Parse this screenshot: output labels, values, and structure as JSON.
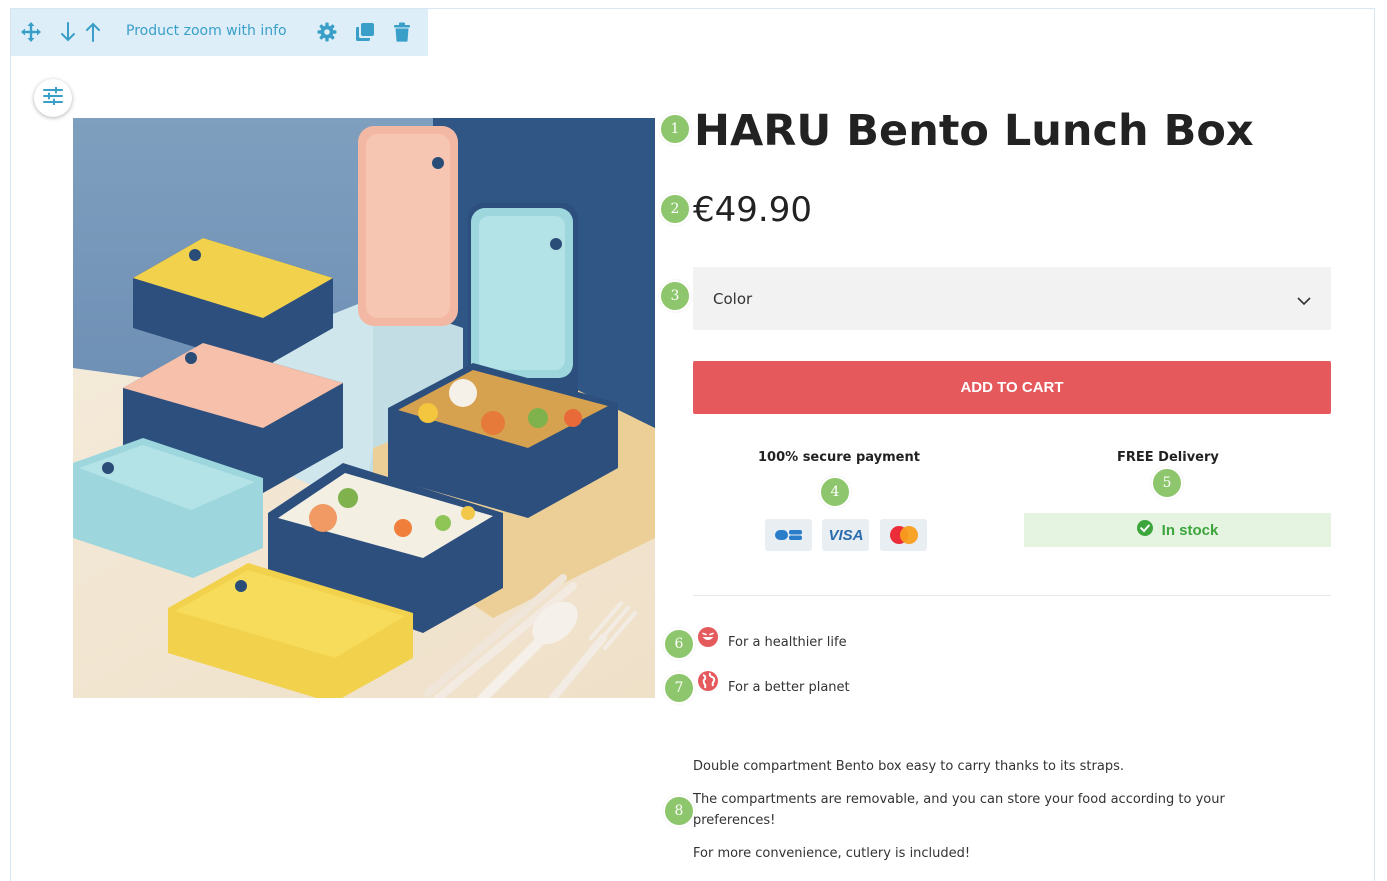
{
  "toolbar": {
    "label": "Product zoom with info",
    "icons": [
      "move-icon",
      "arrow-down-icon",
      "arrow-up-icon",
      "gear-icon",
      "duplicate-icon",
      "trash-icon"
    ],
    "accent": "#3a9fc8"
  },
  "product": {
    "title": "HARU Bento Lunch Box",
    "price": "€49.90",
    "color_select": {
      "label": "Color"
    },
    "add_to_cart": "ADD TO CART",
    "cart_color": "#e5585b"
  },
  "trust": {
    "payment_title": "100% secure payment",
    "cards": [
      "CB",
      "VISA",
      "Mastercard"
    ],
    "delivery_title": "FREE Delivery",
    "stock": "In stock",
    "stock_color": "#3ca53c"
  },
  "features": [
    {
      "icon": "smile-icon",
      "text": "For a healthier life"
    },
    {
      "icon": "globe-icon",
      "text": "For a better planet"
    }
  ],
  "description": [
    "Double compartment Bento box easy to carry thanks to its straps.",
    "The compartments are removable, and you can store your food according to your preferences!",
    "For more convenience, cutlery is included!"
  ],
  "markers": [
    "1",
    "2",
    "3",
    "4",
    "5",
    "6",
    "7",
    "8"
  ]
}
